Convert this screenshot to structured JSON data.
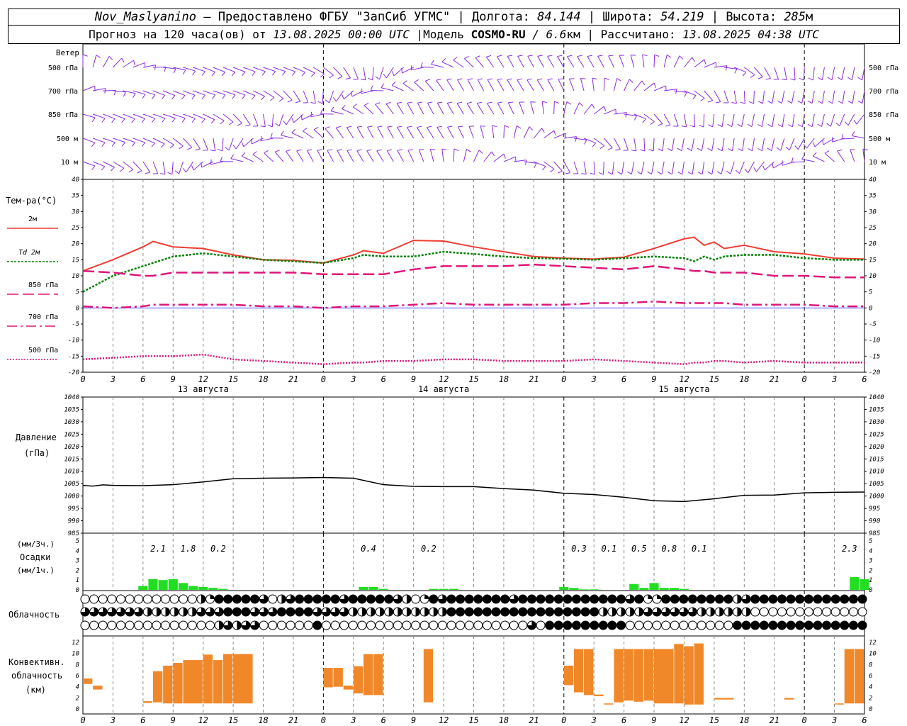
{
  "header": {
    "station": "Nov_Maslyanino",
    "provided": "– Предоставлено ФГБУ \"ЗапСиб УГМС\"",
    "lon_label": "Долгота:",
    "lon": "84.144",
    "lat_label": "Широта:",
    "lat": "54.219",
    "alt_label": "Высота:",
    "alt": "285",
    "alt_unit": "м",
    "sep": "|",
    "forecast_pre": "Прогноз на 120 часа(ов) от",
    "start": "13.08.2025 00:00 UTC",
    "model_label": "Модель",
    "model": "COSMO-RU",
    "res": "/ 6.6",
    "res_unit": "км",
    "calc_label": "Рассчитано:",
    "calc": "13.08.2025 04:38 UTC"
  },
  "colors": {
    "wind": "#8a2be2",
    "t2m": "#f03c32",
    "td": "#008000",
    "t850": "#e0147a",
    "t700": "#e0147a",
    "t500": "#e0147a",
    "pressure": "#000000",
    "precip": "#22dd22",
    "conv": "#f0882a",
    "grid": "#888888"
  },
  "chart_data": [
    {
      "type": "wind",
      "title": "Ветер",
      "levels": [
        "500 гПа",
        "700 гПа",
        "850 гПа",
        "500 м",
        "10 м"
      ],
      "x_start": 0,
      "x_end": 78,
      "x_step": 1
    },
    {
      "type": "line",
      "title": "Тем-ра(°C)",
      "ylim": [
        -20,
        40
      ],
      "yticks": [
        40,
        35,
        30,
        25,
        20,
        15,
        10,
        5,
        0,
        -5,
        -10,
        -15,
        -20
      ],
      "x_unit": "hours since 13.08 00 UTC",
      "x": [
        0,
        3,
        6,
        7,
        9,
        12,
        15,
        18,
        21,
        24,
        27,
        28,
        30,
        33,
        36,
        39,
        42,
        45,
        48,
        51,
        54,
        57,
        60,
        61,
        62,
        63,
        64,
        66,
        69,
        72,
        75,
        78
      ],
      "series": [
        {
          "name": "2м",
          "color": "#f03c32",
          "values": [
            11.5,
            15,
            19,
            20.7,
            19,
            18.5,
            16.5,
            15,
            14.8,
            14,
            16.5,
            17.8,
            17,
            21,
            20.8,
            19,
            17.5,
            16,
            15.5,
            15.2,
            15.8,
            18.5,
            21.5,
            22,
            19.5,
            20.5,
            18.5,
            19.5,
            17.5,
            16.8,
            15.5,
            15.2
          ]
        },
        {
          "name": "Td 2м",
          "color": "#008000",
          "values": [
            5,
            10,
            13,
            14,
            16,
            17,
            16,
            15,
            14.5,
            14,
            15.5,
            16.5,
            16,
            16,
            17.5,
            16.8,
            16,
            15.5,
            15.3,
            15,
            15.5,
            16,
            15.5,
            14.5,
            16,
            15,
            16,
            16.5,
            16.5,
            15.5,
            15,
            15
          ]
        },
        {
          "name": "850 гПа",
          "color": "#e0147a",
          "values": [
            11.5,
            11,
            10,
            10,
            11,
            11,
            11,
            11,
            11,
            10.5,
            10.5,
            10.5,
            10.5,
            12,
            13,
            13,
            13,
            13.5,
            13,
            12.5,
            12,
            13,
            12,
            11.5,
            11.5,
            11,
            11,
            11,
            10,
            10,
            9.5,
            9.5
          ]
        },
        {
          "name": "700 гПа",
          "color": "#e0147a",
          "values": [
            0.5,
            0,
            0.5,
            1,
            1,
            1,
            1,
            0.5,
            0.5,
            0,
            0.5,
            0.5,
            0.5,
            1,
            1.5,
            1,
            1,
            1,
            1,
            1.5,
            1.5,
            2,
            1.5,
            1.5,
            1.5,
            1.5,
            1.5,
            1,
            1,
            1,
            0.5,
            0.5
          ]
        },
        {
          "name": "500 гПа",
          "color": "#e0147a",
          "values": [
            -16,
            -15.5,
            -15,
            -15,
            -15,
            -14.5,
            -16,
            -16.5,
            -17,
            -17.5,
            -17,
            -17,
            -16.5,
            -16.5,
            -16,
            -16,
            -16.5,
            -16.5,
            -16.5,
            -16,
            -16.5,
            -17,
            -17.5,
            -17,
            -17,
            -16.5,
            -16.5,
            -17,
            -16.5,
            -17,
            -17,
            -17
          ]
        }
      ],
      "xticks": [
        "0",
        "3",
        "6",
        "9",
        "12",
        "15",
        "18",
        "21",
        "0",
        "3",
        "6",
        "9",
        "12",
        "15",
        "18",
        "21",
        "0",
        "3",
        "6",
        "9",
        "12",
        "15",
        "18",
        "21",
        "0",
        "3",
        "6"
      ],
      "days": [
        "13 августа",
        "14 августа",
        "15 августа"
      ]
    },
    {
      "type": "line",
      "title": "Давление",
      "ylabel": "(гПа)",
      "ylim": [
        985,
        1040
      ],
      "yticks": [
        1040,
        1035,
        1030,
        1025,
        1020,
        1015,
        1010,
        1005,
        1000,
        995,
        990,
        985
      ],
      "x": [
        0,
        1,
        2,
        3,
        6,
        9,
        12,
        15,
        18,
        21,
        24,
        27,
        30,
        33,
        36,
        39,
        42,
        45,
        48,
        51,
        54,
        57,
        60,
        63,
        66,
        69,
        72,
        75,
        78
      ],
      "values": [
        1004.3,
        1004.0,
        1004.5,
        1004.3,
        1004.2,
        1004.6,
        1005.7,
        1007.0,
        1007.2,
        1007.3,
        1007.5,
        1007.2,
        1004.6,
        1003.9,
        1003.8,
        1003.8,
        1003.0,
        1002.4,
        1001.1,
        1000.6,
        999.5,
        998.1,
        997.8,
        998.9,
        1000.3,
        1000.4,
        1001.3,
        1001.5,
        1001.6
      ]
    },
    {
      "type": "bar",
      "title": "Осадки",
      "ylabel_top": "(мм/3ч.)",
      "ylabel_bottom": "(мм/1ч.)",
      "ylim": [
        0,
        5
      ],
      "yticks": [
        5,
        4,
        3,
        2,
        1,
        0
      ],
      "hours": [
        6,
        7,
        8,
        9,
        10,
        11,
        12,
        13,
        14,
        28,
        29,
        30,
        35,
        36,
        37,
        48,
        49,
        50,
        51,
        55,
        56,
        57,
        58,
        59,
        60,
        77,
        78
      ],
      "values": [
        0.4,
        1.1,
        1.0,
        1.1,
        0.7,
        0.4,
        0.3,
        0.2,
        0.1,
        0.3,
        0.3,
        0.1,
        0.1,
        0.1,
        0.1,
        0.3,
        0.2,
        0.05,
        0.05,
        0.6,
        0.2,
        0.7,
        0.2,
        0.2,
        0.1,
        1.3,
        1.1
      ],
      "labels": [
        {
          "hour": 7.5,
          "text": "2.1"
        },
        {
          "hour": 10.5,
          "text": "1.8"
        },
        {
          "hour": 13.5,
          "text": "0.2"
        },
        {
          "hour": 28.5,
          "text": "0.4"
        },
        {
          "hour": 34.5,
          "text": "0.2"
        },
        {
          "hour": 49.5,
          "text": "0.3"
        },
        {
          "hour": 52.5,
          "text": "0.1"
        },
        {
          "hour": 55.5,
          "text": "0.5"
        },
        {
          "hour": 58.5,
          "text": "0.8"
        },
        {
          "hour": 61.5,
          "text": "0.1"
        },
        {
          "hour": 76.5,
          "text": "2.3"
        }
      ]
    },
    {
      "type": "table",
      "title": "Облачность",
      "scale": "0-4 quarters filled",
      "rows": [
        "0000000000000214444430234444434444432014344444443444444444444341144444444234444444444444",
        "3333333222222333444333444433332222222222244444444444444444222223333332222220000000000000",
        "0000000000000002323300000040000000000000000000000030444444444000000000000444444444444444"
      ]
    },
    {
      "type": "bar",
      "title": "Конвективн. облачность",
      "ylabel": "(км)",
      "ylim": [
        0,
        13
      ],
      "yticks": [
        12,
        10,
        8,
        6,
        4,
        2,
        0
      ],
      "segments": [
        [
          0,
          1,
          4.5,
          5.5
        ],
        [
          1,
          2,
          3.5,
          4.2
        ],
        [
          6,
          7,
          1.1,
          1.4
        ],
        [
          7,
          8,
          1.2,
          6.8
        ],
        [
          8,
          9,
          1.0,
          7.8
        ],
        [
          9,
          10,
          1.0,
          8.3
        ],
        [
          10,
          12,
          1.0,
          8.8
        ],
        [
          12,
          13,
          1.0,
          9.8
        ],
        [
          13,
          14,
          1.0,
          8.8
        ],
        [
          14,
          15,
          1.0,
          9.9
        ],
        [
          15,
          17,
          1.0,
          9.9
        ],
        [
          24,
          25,
          3.9,
          7.4
        ],
        [
          25,
          26,
          4.0,
          7.4
        ],
        [
          26,
          27,
          3.5,
          4.2
        ],
        [
          27,
          28,
          2.8,
          7.7
        ],
        [
          28,
          29,
          2.5,
          9.9
        ],
        [
          29,
          30,
          2.5,
          9.9
        ],
        [
          34,
          35,
          1.2,
          10.8
        ],
        [
          48,
          49,
          4.3,
          7.8
        ],
        [
          49,
          50,
          3.0,
          10.8
        ],
        [
          50,
          51,
          2.5,
          10.8
        ],
        [
          51,
          52,
          2.3,
          2.6
        ],
        [
          52,
          53,
          0.8,
          1.0
        ],
        [
          53,
          54,
          1.2,
          10.8
        ],
        [
          54,
          55,
          1.5,
          10.8
        ],
        [
          55,
          56,
          1.3,
          10.8
        ],
        [
          56,
          57,
          1.5,
          10.8
        ],
        [
          57,
          59,
          1.0,
          10.8
        ],
        [
          59,
          60,
          1.0,
          11.7
        ],
        [
          60,
          61,
          0.8,
          11.3
        ],
        [
          61,
          62,
          0.8,
          11.8
        ],
        [
          63,
          65,
          1.7,
          2.0
        ],
        [
          70,
          71,
          1.7,
          2.0
        ],
        [
          75,
          76,
          0.8,
          1.0
        ],
        [
          76,
          77,
          1.0,
          10.8
        ],
        [
          77,
          78,
          1.0,
          10.8
        ]
      ]
    }
  ]
}
